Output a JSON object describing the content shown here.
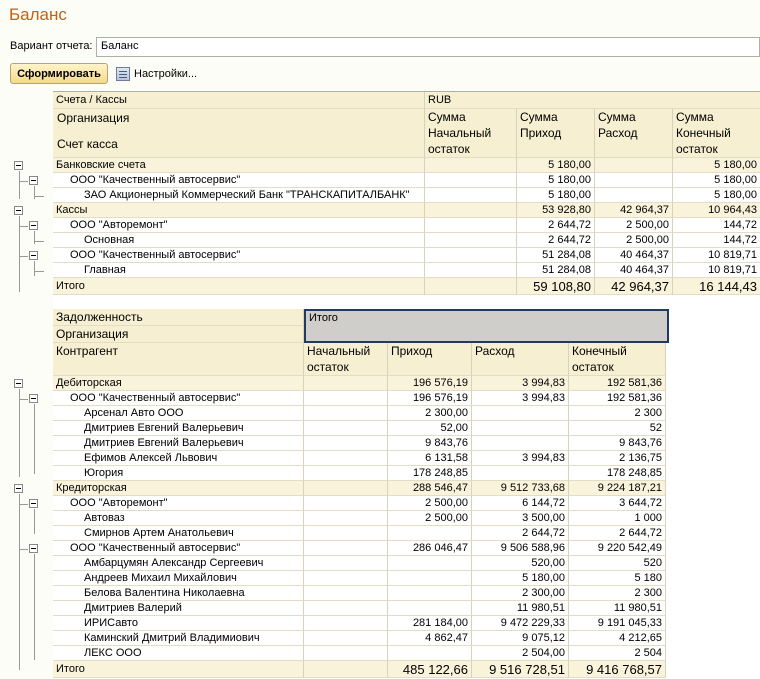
{
  "title": "Баланс",
  "variant": {
    "label": "Вариант отчета:",
    "value": "Баланс"
  },
  "toolbar": {
    "generate_label": "Сформировать",
    "settings_label": "Настройки..."
  },
  "table1": {
    "header": {
      "accounts_label": "Счета / Кассы",
      "currency": "RUB",
      "org_label": "Организация",
      "account_label": "Счет касса",
      "col_start": "Сумма Начальный остаток",
      "col_income": "Сумма Приход",
      "col_expense": "Сумма Расход",
      "col_end": "Сумма Конечный остаток"
    },
    "rows": [
      {
        "name": "Банковские счета",
        "start": "",
        "income": "5 180,00",
        "expense": "",
        "end": "5 180,00"
      },
      {
        "name": "ООО \"Качественный автосервис\"",
        "start": "",
        "income": "5 180,00",
        "expense": "",
        "end": "5 180,00"
      },
      {
        "name": "ЗАО Акционерный Коммерческий Банк \"ТРАНСКАПИТАЛБАНК\"",
        "start": "",
        "income": "5 180,00",
        "expense": "",
        "end": "5 180,00"
      },
      {
        "name": "Кассы",
        "start": "",
        "income": "53 928,80",
        "expense": "42 964,37",
        "end": "10 964,43"
      },
      {
        "name": "ООО \"Авторемонт\"",
        "start": "",
        "income": "2 644,72",
        "expense": "2 500,00",
        "end": "144,72"
      },
      {
        "name": "Основная",
        "start": "",
        "income": "2 644,72",
        "expense": "2 500,00",
        "end": "144,72"
      },
      {
        "name": "ООО \"Качественный автосервис\"",
        "start": "",
        "income": "51 284,08",
        "expense": "40 464,37",
        "end": "10 819,71"
      },
      {
        "name": "Главная",
        "start": "",
        "income": "51 284,08",
        "expense": "40 464,37",
        "end": "10 819,71"
      }
    ],
    "total": {
      "name": "Итого",
      "start": "",
      "income": "59 108,80",
      "expense": "42 964,37",
      "end": "16 144,43"
    }
  },
  "table2": {
    "header": {
      "debt_label": "Задолженность",
      "org_label": "Организация",
      "contractor_label": "Контрагент",
      "itogo_label": "Итого",
      "col_start": "Начальный остаток",
      "col_income": "Приход",
      "col_expense": "Расход",
      "col_end": "Конечный остаток"
    },
    "rows": [
      {
        "name": "Дебиторская",
        "start": "",
        "income": "196 576,19",
        "expense": "3 994,83",
        "end": "192 581,36"
      },
      {
        "name": "ООО \"Качественный автосервис\"",
        "start": "",
        "income": "196 576,19",
        "expense": "3 994,83",
        "end": "192 581,36"
      },
      {
        "name": "Арсенал Авто ООО",
        "start": "",
        "income": "2 300,00",
        "expense": "",
        "end": "2 300"
      },
      {
        "name": "Дмитриев Евгений Валерьевич",
        "start": "",
        "income": "52,00",
        "expense": "",
        "end": "52"
      },
      {
        "name": "Дмитриев Евгений Валерьевич",
        "start": "",
        "income": "9 843,76",
        "expense": "",
        "end": "9 843,76"
      },
      {
        "name": "Ефимов Алексей Львович",
        "start": "",
        "income": "6 131,58",
        "expense": "3 994,83",
        "end": "2 136,75"
      },
      {
        "name": "Югория",
        "start": "",
        "income": "178 248,85",
        "expense": "",
        "end": "178 248,85"
      },
      {
        "name": "Кредиторская",
        "start": "",
        "income": "288 546,47",
        "expense": "9 512 733,68",
        "end": "9 224 187,21"
      },
      {
        "name": "ООО \"Авторемонт\"",
        "start": "",
        "income": "2 500,00",
        "expense": "6 144,72",
        "end": "3 644,72"
      },
      {
        "name": "Автоваз",
        "start": "",
        "income": "2 500,00",
        "expense": "3 500,00",
        "end": "1 000"
      },
      {
        "name": "Смирнов Артем Анатольевич",
        "start": "",
        "income": "",
        "expense": "2 644,72",
        "end": "2 644,72"
      },
      {
        "name": "ООО \"Качественный автосервис\"",
        "start": "",
        "income": "286 046,47",
        "expense": "9 506 588,96",
        "end": "9 220 542,49"
      },
      {
        "name": "Амбарцумян Александр Сергеевич",
        "start": "",
        "income": "",
        "expense": "520,00",
        "end": "520"
      },
      {
        "name": "Андреев Михаил Михайлович",
        "start": "",
        "income": "",
        "expense": "5 180,00",
        "end": "5 180"
      },
      {
        "name": "Белова Валентина Николаевна",
        "start": "",
        "income": "",
        "expense": "2 300,00",
        "end": "2 300"
      },
      {
        "name": "Дмитриев Валерий",
        "start": "",
        "income": "",
        "expense": "11 980,51",
        "end": "11 980,51"
      },
      {
        "name": "ИРИСавто",
        "start": "",
        "income": "281 184,00",
        "expense": "9 472 229,33",
        "end": "9 191 045,33"
      },
      {
        "name": "Каминский Дмитрий Владимиович",
        "start": "",
        "income": "4 862,47",
        "expense": "9 075,12",
        "end": "4 212,65"
      },
      {
        "name": "ЛЕКС ООО",
        "start": "",
        "income": "",
        "expense": "2 504,00",
        "end": "2 504"
      }
    ],
    "total": {
      "name": "Итого",
      "start": "",
      "income": "485 122,66",
      "expense": "9 516 728,51",
      "end": "9 416 768,57"
    }
  }
}
